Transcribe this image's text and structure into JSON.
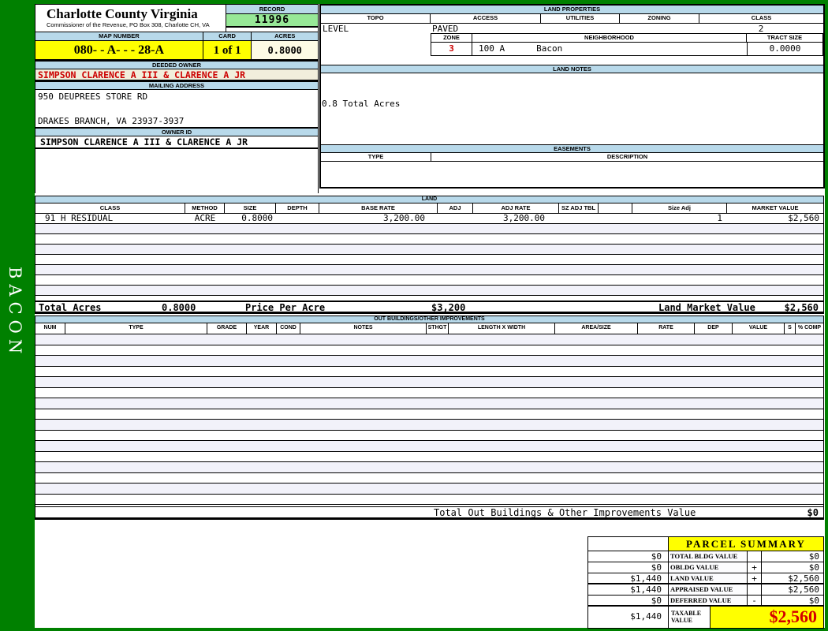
{
  "sidebar": {
    "district": "BACON"
  },
  "header": {
    "county": "Charlotte County Virginia",
    "commissioner": "Commissioner of the Revenue, PO Box 308, Charlotte CH, VA",
    "record_label": "RECORD",
    "record_value": "11996",
    "map_number_label": "MAP NUMBER",
    "map_number": "080-  - A-  -   - 28-A",
    "card_label": "CARD",
    "card_value": "1 of 1",
    "acres_label": "ACRES",
    "acres_value": "0.8000"
  },
  "owner": {
    "deeded_owner_label": "DEEDED OWNER",
    "deeded_owner": "SIMPSON CLARENCE A III & CLARENCE A JR",
    "mailing_address_label": "MAILING ADDRESS",
    "address_line1": "950 DEUPREES STORE RD",
    "address_line2": "DRAKES BRANCH, VA 23937-3937",
    "owner_id_label": "OWNER ID",
    "owner_id": "SIMPSON CLARENCE A III & CLARENCE A JR"
  },
  "land_properties": {
    "title": "LAND PROPERTIES",
    "columns": [
      "TOPO",
      "ACCESS",
      "UTILITIES",
      "ZONING",
      "CLASS"
    ],
    "topo": "LEVEL",
    "access": "PAVED",
    "utilities": "",
    "zoning": "",
    "class": "2",
    "zone_label": "ZONE",
    "zone": "3",
    "neighborhood_label": "NEIGHBORHOOD",
    "neighborhood_code": "100 A",
    "neighborhood_name": "Bacon",
    "tract_size_label": "TRACT SIZE",
    "tract_size": "0.0000"
  },
  "land_notes": {
    "title": "LAND NOTES",
    "note": "0.8 Total Acres"
  },
  "easements": {
    "title": "EASEMENTS",
    "type_label": "TYPE",
    "description_label": "DESCRIPTION"
  },
  "land": {
    "title": "LAND",
    "columns": [
      "CLASS",
      "METHOD",
      "SIZE",
      "DEPTH",
      "BASE RATE",
      "ADJ",
      "ADJ RATE",
      "SZ ADJ TBL",
      "",
      "Size Adj",
      "MARKET VALUE"
    ],
    "rows": [
      [
        "91 H RESIDUAL",
        "ACRE",
        "0.8000",
        "",
        "3,200.00",
        "",
        "3,200.00",
        "",
        "",
        "1",
        "$2,560"
      ]
    ],
    "empty_row_count": 7,
    "totals": {
      "total_acres_label": "Total Acres",
      "total_acres": "0.8000",
      "price_per_acre_label": "Price Per Acre",
      "price_per_acre": "$3,200",
      "market_value_label": "Land Market Value",
      "market_value": "$2,560"
    }
  },
  "out_buildings": {
    "title": "OUT BUILDINGS/OTHER IMPROVEMENTS",
    "columns": [
      "NUM",
      "TYPE",
      "GRADE",
      "YEAR",
      "COND",
      "NOTES",
      "STHGT",
      "LENGTH X WIDTH",
      "AREA/SIZE",
      "RATE",
      "DEP",
      "VALUE",
      "S",
      "% COMP"
    ],
    "empty_row_count": 16,
    "total_label": "Total Out Buildings & Other Improvements Value",
    "total_value": "$0"
  },
  "parcel_summary": {
    "title": "PARCEL SUMMARY",
    "rows": [
      {
        "left": "$0",
        "label": "TOTAL BLDG VALUE",
        "op": "",
        "value": "$0"
      },
      {
        "left": "$0",
        "label": "OBLDG VALUE",
        "op": "+",
        "value": "$0"
      },
      {
        "left": "$1,440",
        "label": "LAND VALUE",
        "op": "+",
        "value": "$2,560"
      },
      {
        "left": "$1,440",
        "label": "APPRAISED VALUE",
        "op": "",
        "value": "$2,560"
      },
      {
        "left": "$0",
        "label": "DEFERRED VALUE",
        "op": "-",
        "value": "$0"
      }
    ],
    "taxable": {
      "left": "$1,440",
      "label_line1": "TAXABLE",
      "label_line2": "VALUE",
      "value": "$2,560"
    }
  },
  "colors": {
    "page_green": "#008000",
    "header_blue": "#B8D9EA",
    "record_green": "#97E897",
    "highlight_yellow": "#FFFF00",
    "cream": "#F1EEDC",
    "alert_red": "#CC0000",
    "stripe": "#F2F2FA"
  }
}
